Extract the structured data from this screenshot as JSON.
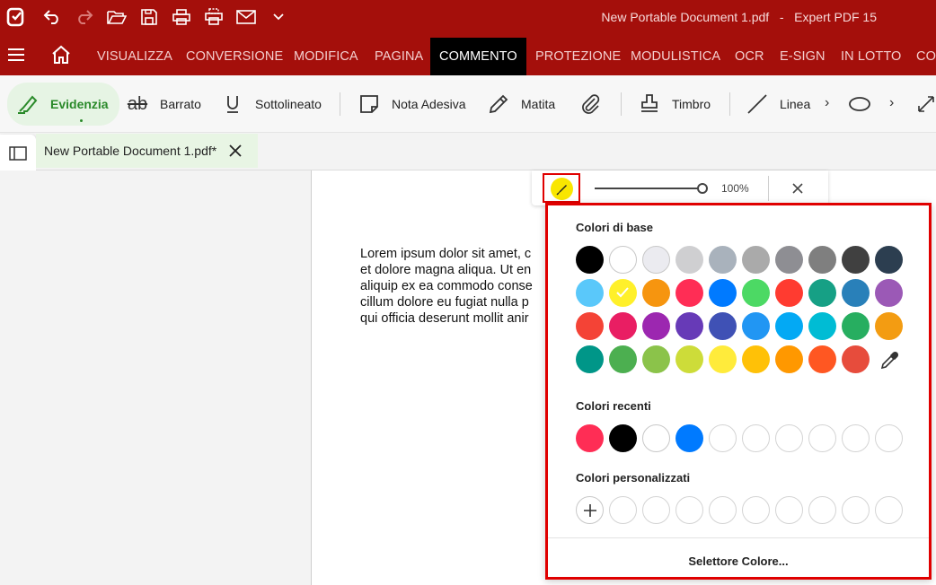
{
  "window": {
    "title": "New Portable Document 1.pdf   -   Expert PDF 15"
  },
  "quick_access": [
    "app-logo-icon",
    "undo-icon",
    "redo-icon",
    "open-folder-icon",
    "save-icon",
    "print-icon",
    "scan-print-icon",
    "email-icon",
    "chevron-down-icon"
  ],
  "menu": {
    "items": [
      {
        "label": "VISUALIZZA"
      },
      {
        "label": "CONVERSIONE"
      },
      {
        "label": "MODIFICA"
      },
      {
        "label": "PAGINA"
      },
      {
        "label": "COMMENTO",
        "active": true
      },
      {
        "label": "PROTEZIONE"
      },
      {
        "label": "MODULISTICA"
      },
      {
        "label": "OCR"
      },
      {
        "label": "E-SIGN"
      },
      {
        "label": "IN LOTTO"
      },
      {
        "label": "CO"
      }
    ]
  },
  "toolbar": {
    "highlight": "Evidenzia",
    "strikethrough": "Barrato",
    "underline": "Sottolineato",
    "sticky_note": "Nota Adesiva",
    "pencil": "Matita",
    "stamp": "Timbro",
    "line": "Linea",
    "more_1": "›",
    "more_2": "›"
  },
  "tab": {
    "name": "New Portable Document 1.pdf*"
  },
  "document": {
    "lines": [
      "Lorem ipsum dolor sit amet, c",
      "et dolore magna aliqua. Ut en",
      "aliquip ex ea commodo conse",
      "cillum dolore eu fugiat nulla p",
      "qui officia deserunt mollit anir"
    ]
  },
  "floatbar": {
    "opacity": "100%",
    "opacity_value": 1.0
  },
  "color_popup": {
    "basic_title": "Colori di base",
    "recent_title": "Colori recenti",
    "custom_title": "Colori personalizzati",
    "picker_label": "Selettore Colore...",
    "selected_color": "#fff02a",
    "basic_colors": [
      [
        "#000000",
        "#ffffff",
        "#ebebf0",
        "#cfcfd1",
        "#a9b2bc",
        "#aaaaaa",
        "#8e8e93",
        "#7f7f7f",
        "#404040",
        "#2c3e50"
      ],
      [
        "#5ac8fa",
        "#fff02a",
        "#f6950f",
        "#ff2d55",
        "#007aff",
        "#4cd964",
        "#ff3b30",
        "#16a085",
        "#2980b9",
        "#9b59b6"
      ],
      [
        "#f44336",
        "#e91e63",
        "#9c27b0",
        "#673ab7",
        "#3f51b5",
        "#2196f3",
        "#03a9f4",
        "#00bcd4",
        "#27ae60",
        "#f39c12"
      ],
      [
        "#009688",
        "#4caf50",
        "#8bc34a",
        "#cddc39",
        "#ffeb3b",
        "#ffc107",
        "#ff9800",
        "#ff5722",
        "#e74c3c"
      ]
    ],
    "recent_colors": [
      "#ff2d55",
      "#000000",
      "#ffffff",
      "#007aff",
      "",
      "",
      "",
      "",
      "",
      ""
    ],
    "custom_colors": [
      "",
      "",
      "",
      "",
      "",
      "",
      "",
      "",
      ""
    ]
  }
}
